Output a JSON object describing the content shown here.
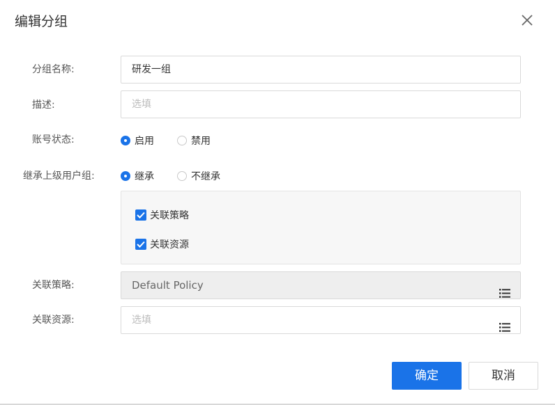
{
  "dialog": {
    "title": "编辑分组",
    "close_icon": "close-icon"
  },
  "form": {
    "group_name": {
      "label": "分组名称:",
      "value": "研发一组"
    },
    "description": {
      "label": "描述:",
      "value": "",
      "placeholder": "选填"
    },
    "account_status": {
      "label": "账号状态:",
      "options": [
        {
          "label": "启用",
          "checked": true
        },
        {
          "label": "禁用",
          "checked": false
        }
      ]
    },
    "inherit_parent": {
      "label": "继承上级用户组:",
      "options": [
        {
          "label": "继承",
          "checked": true
        },
        {
          "label": "不继承",
          "checked": false
        }
      ],
      "checks": [
        {
          "label": "关联策略",
          "checked": true
        },
        {
          "label": "关联资源",
          "checked": true
        }
      ]
    },
    "linked_policy": {
      "label": "关联策略:",
      "value": "Default Policy",
      "icon": "list-icon"
    },
    "linked_resource": {
      "label": "关联资源:",
      "value": "",
      "placeholder": "选填",
      "icon": "list-icon"
    }
  },
  "footer": {
    "confirm_label": "确定",
    "cancel_label": "取消"
  },
  "colors": {
    "primary": "#1a73e8",
    "disabled_bg": "#eeeeee",
    "border": "#d9d9d9"
  }
}
